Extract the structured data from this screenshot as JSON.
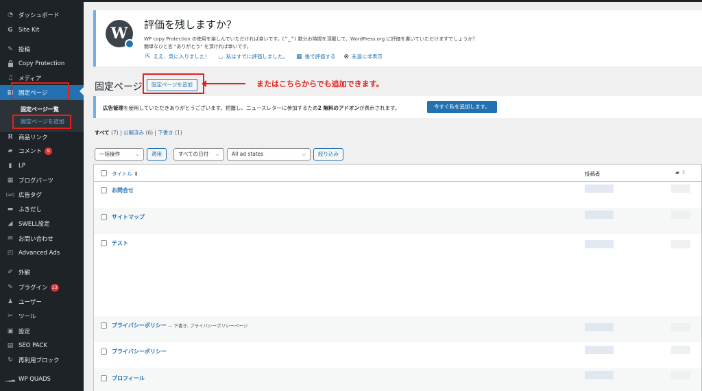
{
  "sidebar": {
    "items": [
      {
        "icon": "dashboard-icon",
        "glyph": "◔",
        "label": "ダッシュボード"
      },
      {
        "icon": "site-kit-icon",
        "glyph": "G",
        "label": "Site Kit"
      },
      {
        "icon": "pin-icon",
        "glyph": "✎",
        "label": "投稿"
      },
      {
        "icon": "lock-icon",
        "glyph": "🔒",
        "label": "Copy Protection"
      },
      {
        "icon": "media-icon",
        "glyph": "♫",
        "label": "メディア"
      },
      {
        "icon": "pages-icon",
        "glyph": "▤",
        "label": "固定ページ"
      },
      {
        "icon": "product-link-icon",
        "glyph": "R",
        "label": "商品リンク"
      },
      {
        "icon": "comment-icon",
        "glyph": "▰",
        "label": "コメント",
        "badge": "9"
      },
      {
        "icon": "lp-icon",
        "glyph": "▮",
        "label": "LP"
      },
      {
        "icon": "blog-parts-icon",
        "glyph": "▦",
        "label": "ブログパーツ"
      },
      {
        "icon": "ad-tag-icon",
        "glyph": "[ad]",
        "label": "広告タグ"
      },
      {
        "icon": "balloon-icon",
        "glyph": "▬",
        "label": "ふきだし"
      },
      {
        "icon": "swell-icon",
        "glyph": "◢",
        "label": "SWELL設定"
      },
      {
        "icon": "mail-icon",
        "glyph": "✉",
        "label": "お問い合わせ"
      },
      {
        "icon": "advanced-ads-icon",
        "glyph": "◰",
        "label": "Advanced Ads"
      },
      {
        "icon": "appearance-icon",
        "glyph": "✐",
        "label": "外観"
      },
      {
        "icon": "plugin-icon",
        "glyph": "✎",
        "label": "プラグイン",
        "badge": "13"
      },
      {
        "icon": "users-icon",
        "glyph": "♟",
        "label": "ユーザー"
      },
      {
        "icon": "tools-icon",
        "glyph": "✂",
        "label": "ツール"
      },
      {
        "icon": "settings-icon",
        "glyph": "▣",
        "label": "設定"
      },
      {
        "icon": "seo-pack-icon",
        "glyph": "▤",
        "label": "SEO PACK"
      },
      {
        "icon": "reusable-block-icon",
        "glyph": "↻",
        "label": "再利用ブロック"
      },
      {
        "icon": "wp-quads-icon",
        "glyph": "▁▂▃",
        "label": "WP QUADS"
      }
    ],
    "submenu": {
      "current": "固定ページ一覧",
      "add_new": "固定ページを追加"
    }
  },
  "notice": {
    "title": "評価を残しますか？",
    "line1": "WP copy Protection の使用を楽しんでいただければ幸いです。(^_^) 数分お時間を頂戴して、WordPress.org に評価を書いていただけますでしょうか？",
    "line2": "簡単なひと言 \"ありがとう\" を頂ければ幸いです。",
    "actions": [
      {
        "icon": "external-link-icon",
        "glyph": "⇱",
        "label": "ええ、気に入りました！"
      },
      {
        "icon": "smile-icon",
        "glyph": "◡",
        "label": "私はすでに評価しました。"
      },
      {
        "icon": "calendar-icon",
        "glyph": "▦",
        "label": "後で評価する"
      },
      {
        "icon": "dismiss-icon",
        "glyph": "⊗",
        "label": "永遠に非表示"
      }
    ]
  },
  "page": {
    "title": "固定ページ",
    "add_button": "固定ページを追加",
    "annotation": "またはこちらからでも追加できます。"
  },
  "ad_notice": {
    "text_prefix": "広告管理",
    "text_mid": "を使用していただきありがとうございます。把握し、ニュースレターに参加するため",
    "text_bold": "2 無料のアドオン",
    "text_suffix": "が表示されます。",
    "button": "今すぐ私を追加します。"
  },
  "views": {
    "all": "すべて",
    "all_count": "(7)",
    "published": "公開済み",
    "published_count": "(6)",
    "draft": "下書き",
    "draft_count": "(1)"
  },
  "filters": {
    "bulk": "一括操作",
    "apply": "適用",
    "dates": "すべての日付",
    "ad_states": "All ad states",
    "filter": "絞り込み"
  },
  "table": {
    "col_title": "タイトル",
    "col_author": "投稿者",
    "rows": [
      {
        "title": "お問合せ",
        "state": ""
      },
      {
        "title": "サイトマップ",
        "state": ""
      },
      {
        "title": "テスト",
        "state": ""
      },
      {
        "title": "プライバシーポリシー",
        "state": " — 下書き, プライバシーポリシーページ"
      },
      {
        "title": "プライバシーポリシー",
        "state": ""
      },
      {
        "title": "プロフィール",
        "state": ""
      }
    ]
  },
  "colors": {
    "sidebar_bg": "#1d2327",
    "accent": "#2271b1",
    "highlight_red": "#e2211c"
  }
}
